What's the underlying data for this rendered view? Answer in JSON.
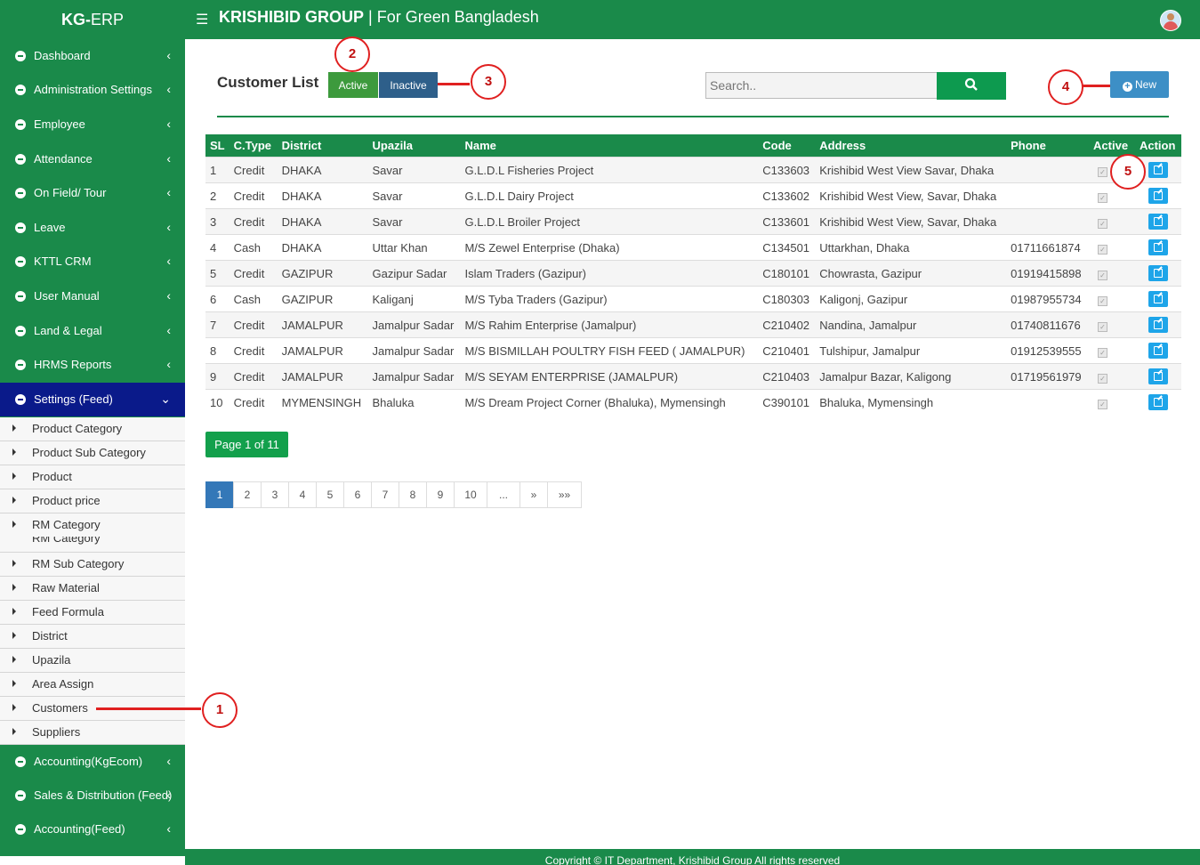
{
  "brand": {
    "prefix": "KG-",
    "suffix": "ERP"
  },
  "header": {
    "company_bold": "KRISHIBID GROUP",
    "company_rest": " | For Green Bangladesh",
    "menu_icon": "hamburger-icon",
    "avatar_icon": "user-avatar-icon"
  },
  "sidebar": {
    "items_top": [
      {
        "label": "Dashboard"
      },
      {
        "label": "Administration Settings"
      },
      {
        "label": "Employee"
      },
      {
        "label": "Attendance"
      },
      {
        "label": "On Field/ Tour"
      },
      {
        "label": "Leave"
      },
      {
        "label": "KTTL CRM"
      },
      {
        "label": "User Manual"
      },
      {
        "label": "Land & Legal"
      },
      {
        "label": "HRMS Reports"
      }
    ],
    "active": {
      "label": "Settings (Feed)"
    },
    "submenu": [
      {
        "label": "Product Category"
      },
      {
        "label": "Product Sub Category"
      },
      {
        "label": "Product"
      },
      {
        "label": "Product price"
      },
      {
        "label": "RM Category"
      },
      {
        "label": "RM Sub Category"
      },
      {
        "label": "Raw Material"
      },
      {
        "label": "Feed Formula"
      },
      {
        "label": "District"
      },
      {
        "label": "Upazila"
      },
      {
        "label": "Area Assign"
      },
      {
        "label": "Customers"
      },
      {
        "label": "Suppliers"
      }
    ],
    "items_bottom": [
      {
        "label": "Accounting(KgEcom)"
      },
      {
        "label": "Sales & Distribution (Feed)"
      },
      {
        "label": "Accounting(Feed)"
      }
    ]
  },
  "main": {
    "title": "Customer List",
    "active_label": "Active",
    "inactive_label": "Inactive",
    "search_placeholder": "Search..",
    "new_label": "New",
    "columns": [
      "SL",
      "C.Type",
      "District",
      "Upazila",
      "Name",
      "Code",
      "Address",
      "Phone",
      "Active",
      "Action"
    ],
    "rows": [
      {
        "sl": "1",
        "ctype": "Credit",
        "district": "DHAKA",
        "upazila": "Savar",
        "name": "G.L.D.L Fisheries Project",
        "code": "C133603",
        "address": "Krishibid West View Savar, Dhaka",
        "phone": ""
      },
      {
        "sl": "2",
        "ctype": "Credit",
        "district": "DHAKA",
        "upazila": "Savar",
        "name": "G.L.D.L Dairy Project",
        "code": "C133602",
        "address": "Krishibid West View, Savar, Dhaka",
        "phone": ""
      },
      {
        "sl": "3",
        "ctype": "Credit",
        "district": "DHAKA",
        "upazila": "Savar",
        "name": "G.L.D.L Broiler Project",
        "code": "C133601",
        "address": "Krishibid West View, Savar, Dhaka",
        "phone": ""
      },
      {
        "sl": "4",
        "ctype": "Cash",
        "district": "DHAKA",
        "upazila": "Uttar Khan",
        "name": "M/S Zewel Enterprise (Dhaka)",
        "code": "C134501",
        "address": "Uttarkhan, Dhaka",
        "phone": "01711661874"
      },
      {
        "sl": "5",
        "ctype": "Credit",
        "district": "GAZIPUR",
        "upazila": "Gazipur Sadar",
        "name": "Islam Traders (Gazipur)",
        "code": "C180101",
        "address": "Chowrasta, Gazipur",
        "phone": "01919415898"
      },
      {
        "sl": "6",
        "ctype": "Cash",
        "district": "GAZIPUR",
        "upazila": "Kaliganj",
        "name": "M/S Tyba Traders (Gazipur)",
        "code": "C180303",
        "address": "Kaligonj, Gazipur",
        "phone": "01987955734"
      },
      {
        "sl": "7",
        "ctype": "Credit",
        "district": "JAMALPUR",
        "upazila": "Jamalpur Sadar",
        "name": "M/S Rahim Enterprise (Jamalpur)",
        "code": "C210402",
        "address": "Nandina, Jamalpur",
        "phone": "01740811676"
      },
      {
        "sl": "8",
        "ctype": "Credit",
        "district": "JAMALPUR",
        "upazila": "Jamalpur Sadar",
        "name": "M/S BISMILLAH POULTRY FISH FEED ( JAMALPUR)",
        "code": "C210401",
        "address": "Tulshipur, Jamalpur",
        "phone": "01912539555"
      },
      {
        "sl": "9",
        "ctype": "Credit",
        "district": "JAMALPUR",
        "upazila": "Jamalpur Sadar",
        "name": "M/S SEYAM ENTERPRISE (JAMALPUR)",
        "code": "C210403",
        "address": "Jamalpur Bazar, Kaligong",
        "phone": "01719561979"
      },
      {
        "sl": "10",
        "ctype": "Credit",
        "district": "MYMENSINGH",
        "upazila": "Bhaluka",
        "name": "M/S Dream Project Corner (Bhaluka), Mymensingh",
        "code": "C390101",
        "address": "Bhaluka, Mymensingh",
        "phone": ""
      }
    ],
    "page_info": "Page 1 of 11",
    "pages": [
      "1",
      "2",
      "3",
      "4",
      "5",
      "6",
      "7",
      "8",
      "9",
      "10",
      "...",
      "»",
      "»»"
    ]
  },
  "callouts": [
    "1",
    "2",
    "3",
    "4",
    "5"
  ],
  "footer": {
    "text": "Copyright © IT Department, Krishibid Group All rights reserved"
  },
  "colors": {
    "brand_green": "#1a8a4a",
    "active_menu": "#0a1a8a",
    "callout_red": "#e02020"
  }
}
